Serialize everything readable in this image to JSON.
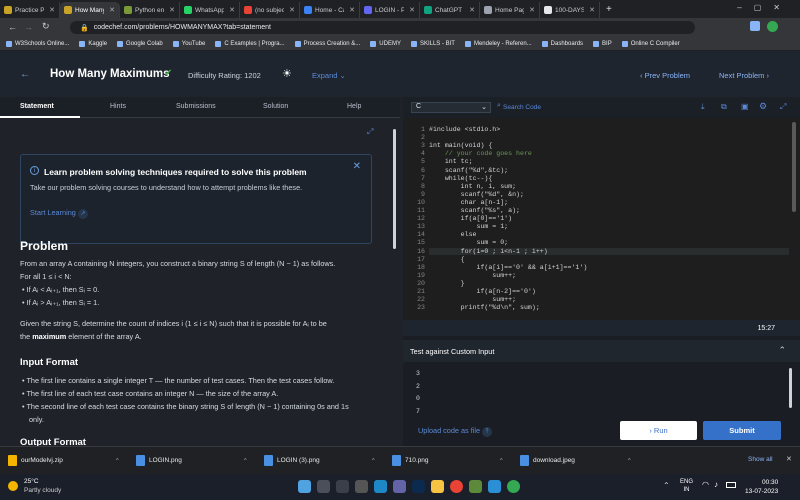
{
  "browser": {
    "tabs": [
      {
        "label": "Practice Pr",
        "favicon": "#c9a227"
      },
      {
        "label": "How Many",
        "favicon": "#c9a227",
        "active": true
      },
      {
        "label": "Python en",
        "favicon": "#7a9a3a"
      },
      {
        "label": "WhatsApp",
        "favicon": "#25d366"
      },
      {
        "label": "(no subject",
        "favicon": "#ea4335"
      },
      {
        "label": "Home - Ca",
        "favicon": "#3b82f6"
      },
      {
        "label": "LOGIN - Po",
        "favicon": "#6366f1"
      },
      {
        "label": "ChatGPT",
        "favicon": "#10a37f"
      },
      {
        "label": "Home Page",
        "favicon": "#9ca3af"
      },
      {
        "label": "100-DAYS",
        "favicon": "#e5e7eb"
      }
    ],
    "url": "codechef.com/problems/HOWMANYMAX?tab=statement",
    "bookmarks": [
      "W3Schools Online...",
      "Kaggle",
      "Google Colab",
      "YouTube",
      "C Examples | Progra...",
      "Process Creation &...",
      "UDEMY",
      "SKILLS - BIT",
      "Mendeley - Referen...",
      "Dashboards",
      "BIP",
      "Online C Compiler"
    ]
  },
  "header": {
    "title": "How Many Maximums",
    "difficulty": "Difficulty Rating: 1202",
    "expand": "Expand",
    "prev": "Prev Problem",
    "next": "Next Problem"
  },
  "subtabs": [
    "Statement",
    "Hints",
    "Submissions",
    "Solution",
    "Help"
  ],
  "banner": {
    "title": "Learn problem solving techniques required to solve this problem",
    "body": "Take our problem solving courses to understand how to attempt problems like these.",
    "link": "Start Learning"
  },
  "problem": {
    "heading": "Problem",
    "p1": "From an array A containing N integers, you construct a binary string S of length (N − 1) as follows.",
    "p1b": "For all 1 ≤ i < N:",
    "b1": "If Aᵢ < Aᵢ₊₁, then Sᵢ = 0.",
    "b2": "If Aᵢ > Aᵢ₊₁, then Sᵢ = 1.",
    "p2": "Given the string S, determine the count of indices i (1 ≤ i ≤ N) such that it is possible for Aᵢ to be",
    "p2b_pre": "the",
    "p2b_bold": "maximum",
    "p2b_post": "element of the array A.",
    "input_heading": "Input Format",
    "i1": "The first line contains a single integer T — the number of test cases. Then the test cases follow.",
    "i2": "The first line of each test case contains an integer N — the size of the array A.",
    "i3": "The second line of each test case contains the binary string S of length (N − 1) containing 0s and 1s",
    "i3b": "only.",
    "output_heading": "Output Format"
  },
  "editor": {
    "language": "C",
    "search": "Search Code",
    "time": "15:27",
    "custom_label": "Test against Custom Input",
    "input_lines": [
      "3",
      "2",
      "0",
      "7"
    ],
    "upload": "Upload code as file",
    "run": "Run",
    "submit": "Submit",
    "lines": [
      [
        "1",
        "#include <stdio.h>"
      ],
      [
        "2",
        ""
      ],
      [
        "3",
        "int main(void) {"
      ],
      [
        "4",
        "    // your code goes here"
      ],
      [
        "5",
        "    int tc;"
      ],
      [
        "6",
        "    scanf(\"%d\",&tc);"
      ],
      [
        "7",
        "    while(tc--){"
      ],
      [
        "8",
        "        int n, i, sum;"
      ],
      [
        "9",
        "        scanf(\"%d\", &n);"
      ],
      [
        "10",
        "        char a[n-1];"
      ],
      [
        "11",
        "        scanf(\"%s\", a);"
      ],
      [
        "12",
        "        if(a[0]=='1')"
      ],
      [
        "13",
        "            sum = 1;"
      ],
      [
        "14",
        "        else"
      ],
      [
        "15",
        "            sum = 0;"
      ],
      [
        "16",
        "        for(i=0 ; i<n-1 ; i++)"
      ],
      [
        "17",
        "        {"
      ],
      [
        "18",
        "            if(a[i]=='0' && a[i+1]=='1')"
      ],
      [
        "19",
        "                sum++;"
      ],
      [
        "20",
        "        }"
      ],
      [
        "21",
        "            if(a[n-2]=='0')"
      ],
      [
        "22",
        "                sum++;"
      ],
      [
        "23",
        "        printf(\"%d\\n\", sum);"
      ]
    ]
  },
  "downloads": {
    "items": [
      "ourModelvj.zip",
      "LOGIN.png",
      "LOGIN (3).png",
      "710.png",
      "download.jpeg"
    ],
    "show_all": "Show all"
  },
  "taskbar": {
    "temp": "25°C",
    "weather": "Partly cloudy",
    "lang1": "ENG",
    "lang2": "IN",
    "time": "00:30",
    "date": "13-07-2023"
  }
}
